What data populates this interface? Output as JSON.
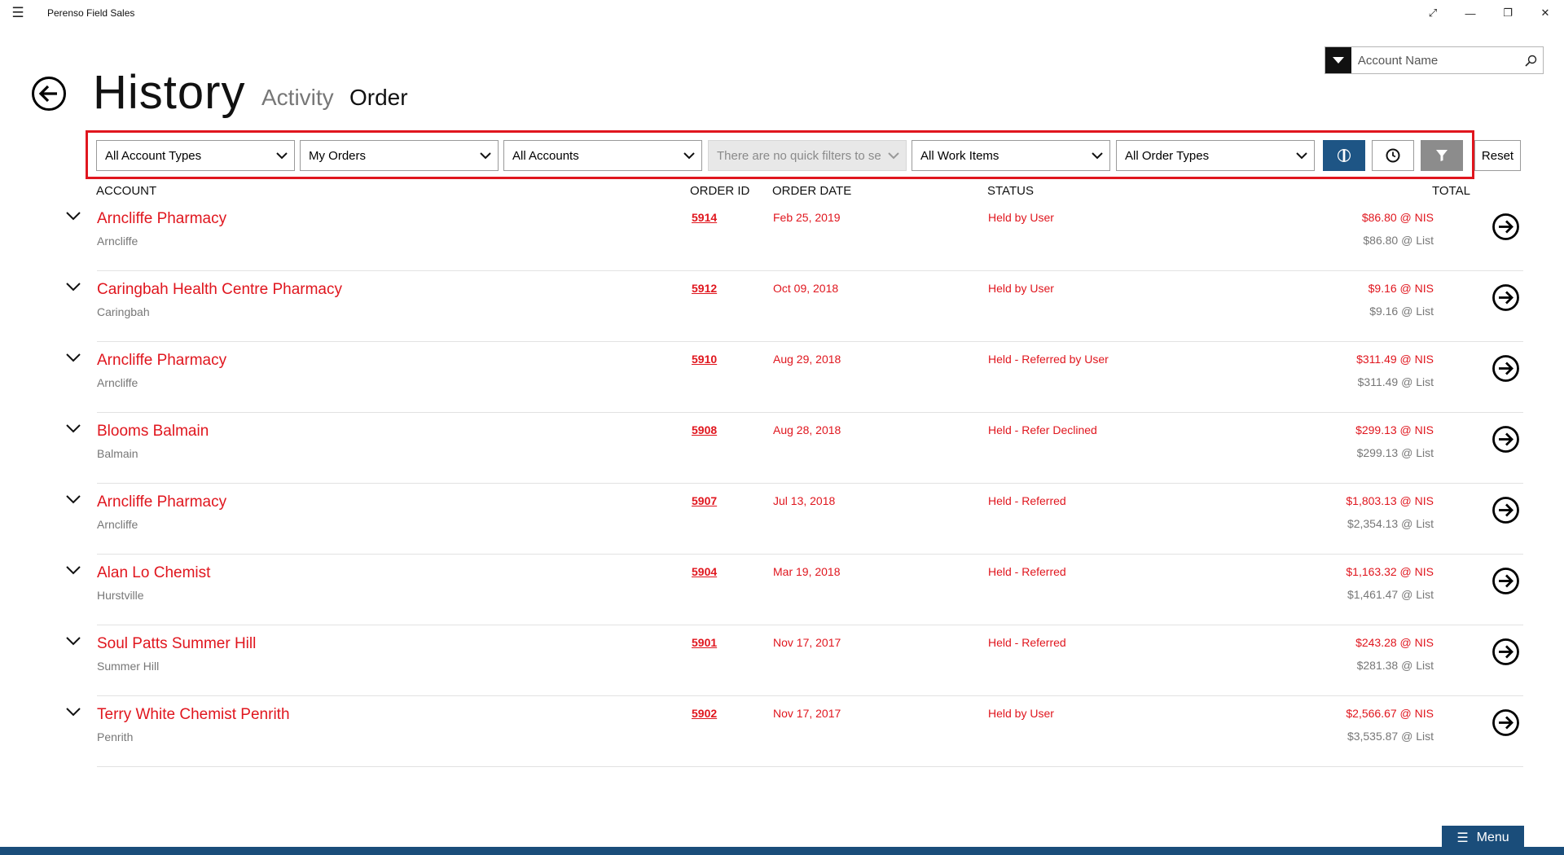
{
  "app": {
    "title": "Perenso Field Sales"
  },
  "window_controls": {
    "expand": "⤢",
    "minimize": "—",
    "restore": "❐",
    "close": "✕"
  },
  "search": {
    "placeholder": "Account Name"
  },
  "header": {
    "title": "History",
    "tabs": [
      {
        "label": "Activity",
        "active": false
      },
      {
        "label": "Order",
        "active": true
      }
    ]
  },
  "filters": {
    "account_types": "All Account Types",
    "orders": "My Orders",
    "accounts": "All Accounts",
    "quick_filters": "There are no quick filters to sel",
    "work_items": "All Work Items",
    "order_types": "All Order Types",
    "reset_label": "Reset"
  },
  "columns": {
    "account": "ACCOUNT",
    "order_id": "ORDER ID",
    "order_date": "ORDER DATE",
    "status": "STATUS",
    "total": "TOTAL"
  },
  "orders": [
    {
      "account": "Arncliffe Pharmacy",
      "suburb": "Arncliffe",
      "order_id": "5914",
      "date": "Feb 25, 2019",
      "status": "Held by User",
      "total_nis": "$86.80 @ NIS",
      "total_list": "$86.80 @ List"
    },
    {
      "account": "Caringbah Health Centre Pharmacy",
      "suburb": "Caringbah",
      "order_id": "5912",
      "date": "Oct 09, 2018",
      "status": "Held by User",
      "total_nis": "$9.16 @ NIS",
      "total_list": "$9.16 @ List"
    },
    {
      "account": "Arncliffe Pharmacy",
      "suburb": "Arncliffe",
      "order_id": "5910",
      "date": "Aug 29, 2018",
      "status": "Held - Referred by User",
      "total_nis": "$311.49 @ NIS",
      "total_list": "$311.49 @ List"
    },
    {
      "account": "Blooms Balmain",
      "suburb": "Balmain",
      "order_id": "5908",
      "date": "Aug 28, 2018",
      "status": "Held - Refer Declined",
      "total_nis": "$299.13 @ NIS",
      "total_list": "$299.13 @ List"
    },
    {
      "account": "Arncliffe Pharmacy",
      "suburb": "Arncliffe",
      "order_id": "5907",
      "date": "Jul 13, 2018",
      "status": "Held - Referred",
      "total_nis": "$1,803.13 @ NIS",
      "total_list": "$2,354.13 @ List"
    },
    {
      "account": "Alan Lo Chemist",
      "suburb": "Hurstville",
      "order_id": "5904",
      "date": "Mar 19, 2018",
      "status": "Held - Referred",
      "total_nis": "$1,163.32 @ NIS",
      "total_list": "$1,461.47 @ List"
    },
    {
      "account": "Soul Patts Summer Hill",
      "suburb": "Summer Hill",
      "order_id": "5901",
      "date": "Nov 17, 2017",
      "status": "Held - Referred",
      "total_nis": "$243.28 @ NIS",
      "total_list": "$281.38 @ List"
    },
    {
      "account": "Terry White Chemist Penrith",
      "suburb": "Penrith",
      "order_id": "5902",
      "date": "Nov 17, 2017",
      "status": "Held by User",
      "total_nis": "$2,566.67 @ NIS",
      "total_list": "$3,535.87 @ List"
    }
  ],
  "bottom": {
    "menu_label": "Menu",
    "menu_icon": "☰"
  },
  "colors": {
    "accent_red": "#e0161e",
    "brand_blue": "#1a4d7a",
    "active_toggle_blue": "#1e5585"
  }
}
